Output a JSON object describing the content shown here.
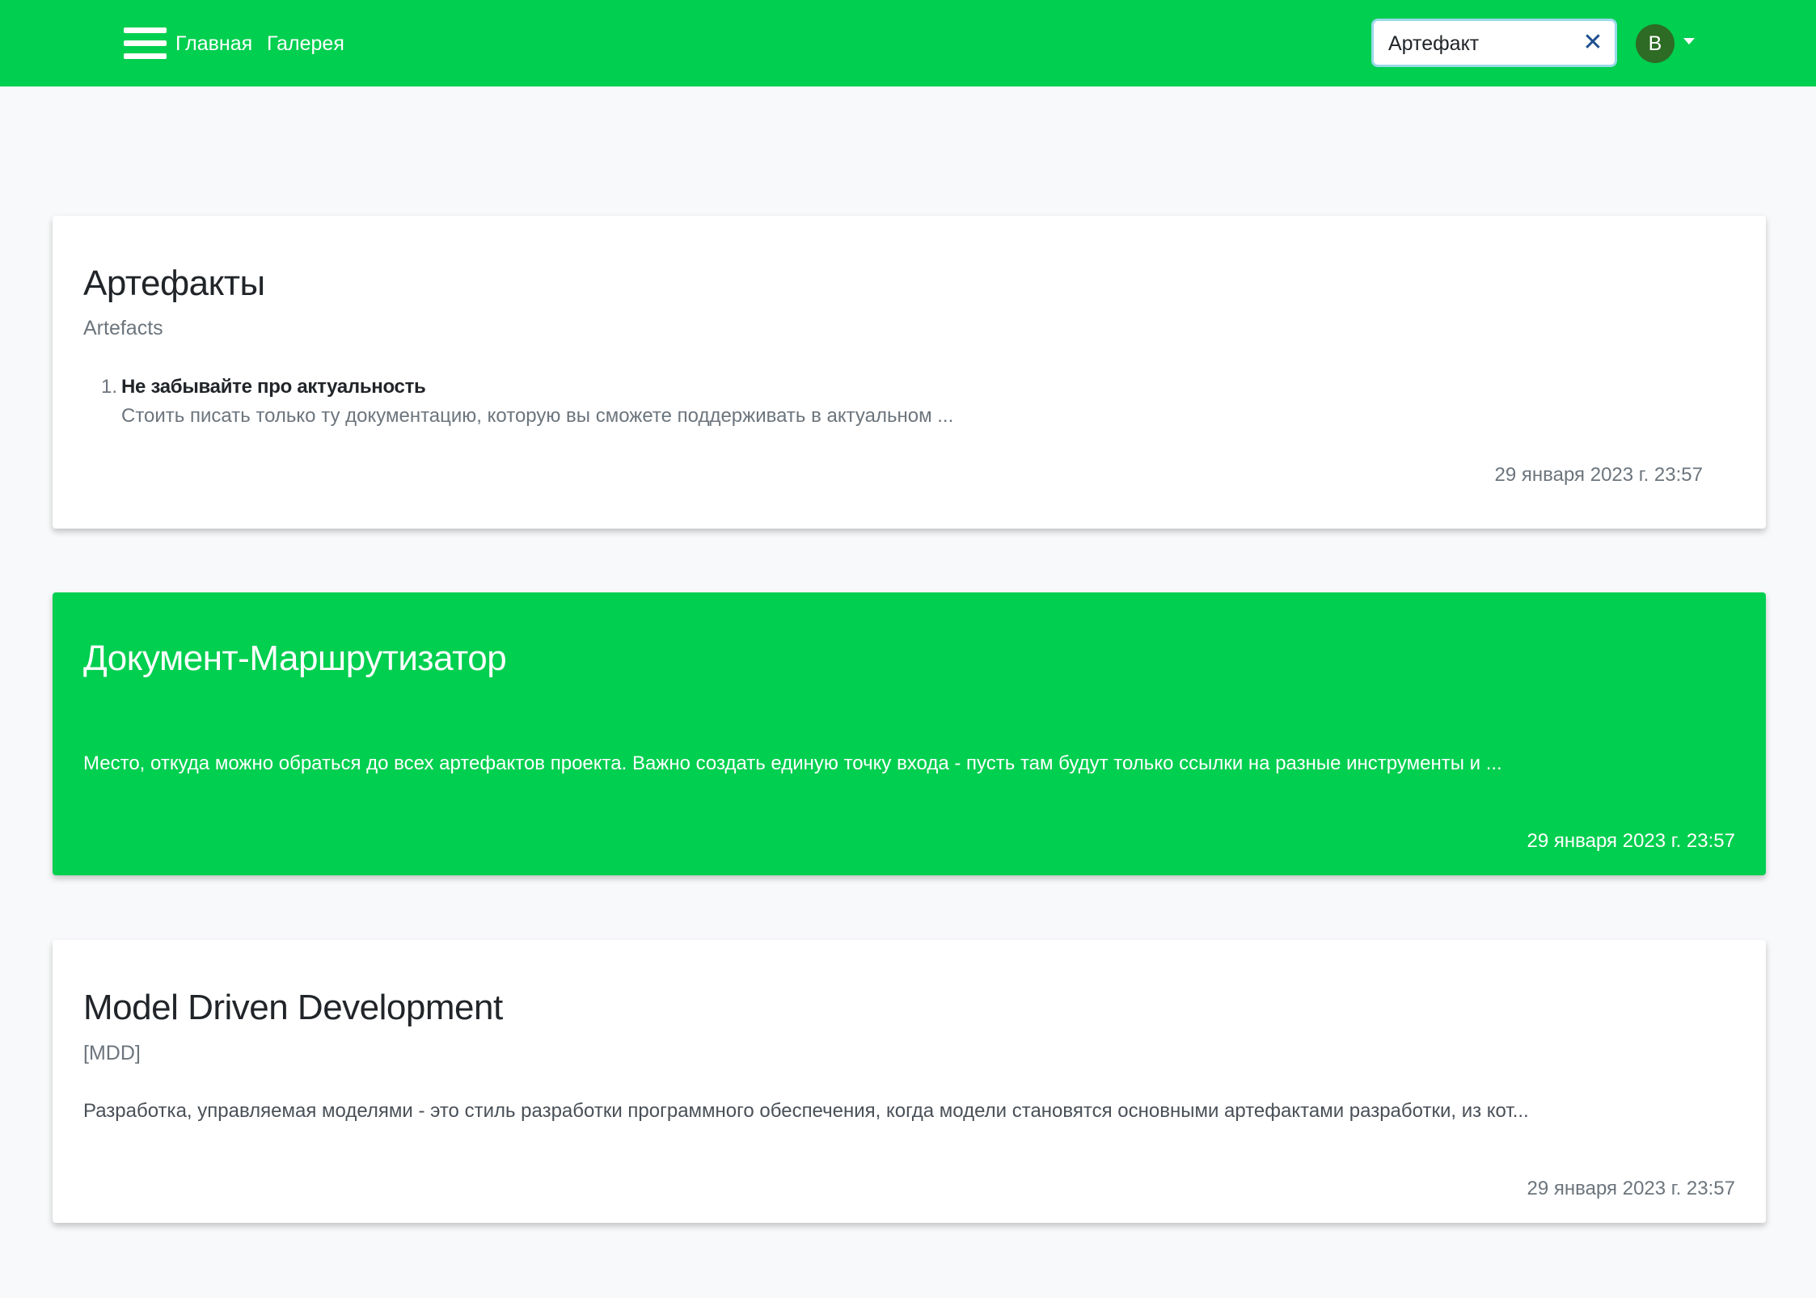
{
  "nav": {
    "menu_icon": "hamburger-menu-icon",
    "links": [
      "Главная",
      "Галерея"
    ],
    "search": {
      "value": "Артефакт",
      "clear_icon": "close-icon"
    },
    "avatar_letter": "B",
    "avatar_color": "#2e6b24",
    "bar_color": "#00cf4f"
  },
  "cards": [
    {
      "title": "Артефакты",
      "subtitle": "Artefacts",
      "list": [
        {
          "number": "1.",
          "title": "Не забывайте про актуальность",
          "text": "Стоить писать только ту документацию, которую вы сможете поддерживать в актуальном ..."
        }
      ],
      "date": "29 января 2023 г. 23:57"
    },
    {
      "title": "Документ-Маршрутизатор",
      "text": "Место, откуда можно обраться до всех артефактов проекта. Важно создать единую точку входа - пусть там будут только ссылки на разные инструменты и ...",
      "date": "29 января 2023 г. 23:57",
      "accent_color": "#00cf4f"
    },
    {
      "title": "Model Driven Development",
      "subtitle": "[MDD]",
      "text": "Разработка, управляемая моделями - это стиль разработки программного обеспечения, когда модели становятся основными артефактами разработки, из кот...",
      "date": "29 января 2023 г. 23:57"
    }
  ]
}
